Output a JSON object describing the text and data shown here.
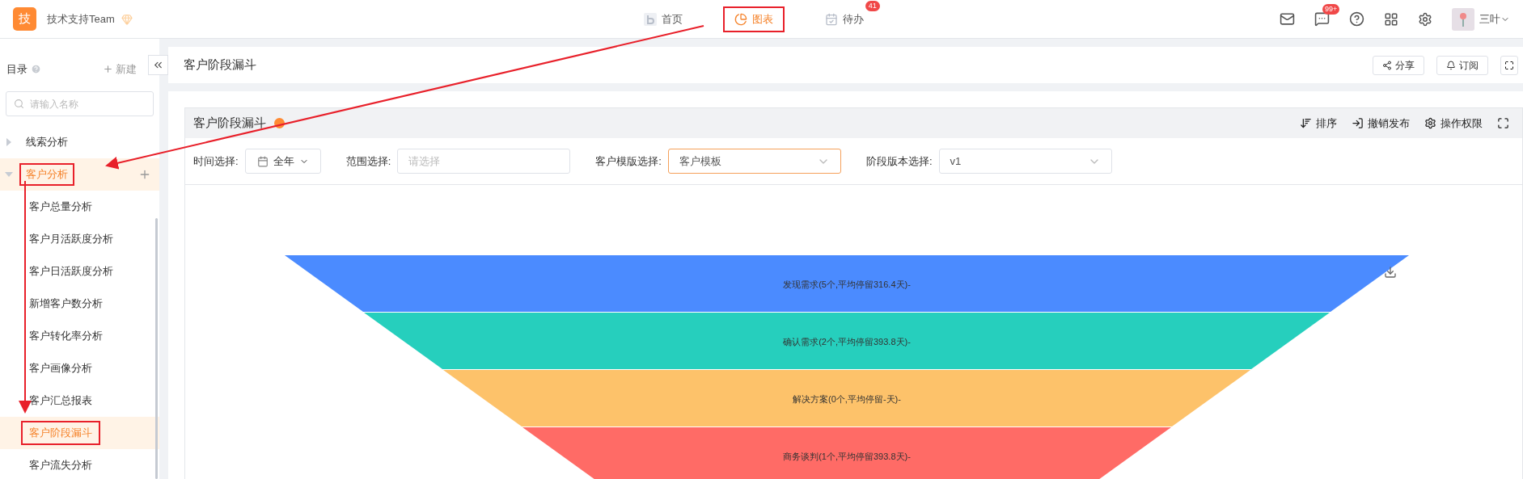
{
  "app": {
    "logo_text": "技",
    "team": "技术支持Team"
  },
  "nav": [
    {
      "label": "首页",
      "selected": false,
      "highlighted": false
    },
    {
      "label": "图表",
      "selected": true,
      "highlighted": true
    },
    {
      "label": "待办",
      "selected": false,
      "highlighted": false,
      "badge": "41"
    }
  ],
  "toolbar": {
    "message_badge": "99+",
    "user": "三叶"
  },
  "sidebar": {
    "title": "目录",
    "new_label": "新建",
    "search": {
      "placeholder": "请输入名称"
    },
    "tree": [
      {
        "label": "线索分析",
        "expanded": false,
        "highlighted": false
      },
      {
        "label": "客户分析",
        "expanded": true,
        "highlighted": true,
        "children": [
          {
            "label": "客户总量分析",
            "selected": false,
            "highlighted": false
          },
          {
            "label": "客户月活跃度分析",
            "selected": false,
            "highlighted": false
          },
          {
            "label": "客户日活跃度分析",
            "selected": false,
            "highlighted": false
          },
          {
            "label": "新增客户数分析",
            "selected": false,
            "highlighted": false
          },
          {
            "label": "客户转化率分析",
            "selected": false,
            "highlighted": false
          },
          {
            "label": "客户画像分析",
            "selected": false,
            "highlighted": false
          },
          {
            "label": "客户汇总报表",
            "selected": false,
            "highlighted": false
          },
          {
            "label": "客户阶段漏斗",
            "selected": true,
            "highlighted": true
          },
          {
            "label": "客户流失分析",
            "selected": false,
            "highlighted": false
          }
        ]
      }
    ]
  },
  "page": {
    "title": "客户阶段漏斗",
    "buttons": [
      "分享",
      "订阅"
    ]
  },
  "report": {
    "title": "客户阶段漏斗",
    "actions": [
      "排序",
      "撤销发布",
      "操作权限"
    ],
    "filters": [
      {
        "kind": "date",
        "label": "时间选择:",
        "value": "全年"
      },
      {
        "kind": "select",
        "label": "范围选择:",
        "placeholder": "请选择",
        "focused": false
      },
      {
        "kind": "select",
        "label": "客户模版选择:",
        "value": "客户模板",
        "focused": true
      },
      {
        "kind": "select",
        "label": "阶段版本选择:",
        "value": "v1",
        "focused": false
      }
    ],
    "funnel": {
      "stages": [
        {
          "label": "发现需求(5个,平均停留316.4天)-",
          "color": "#4b8bff"
        },
        {
          "label": "确认需求(2个,平均停留393.8天)-",
          "color": "#26cfbd"
        },
        {
          "label": "解决方案(0个,平均停留-天)-",
          "color": "#fdc26a"
        },
        {
          "label": "商务谈判(1个,平均停留393.8天)-",
          "color": "#ff6b66"
        }
      ]
    }
  }
}
